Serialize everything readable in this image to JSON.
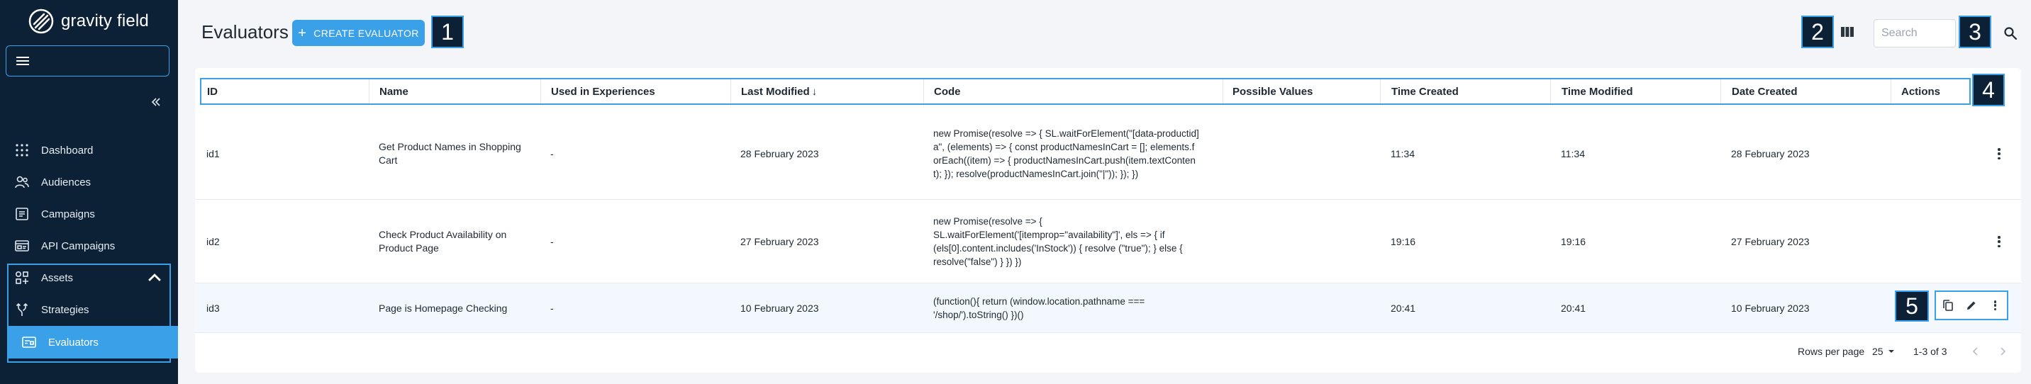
{
  "app": {
    "logo_text": "gravity field"
  },
  "sidebar": {
    "items": [
      {
        "label": "Dashboard",
        "icon": "grid-dots-icon"
      },
      {
        "label": "Audiences",
        "icon": "people-icon"
      },
      {
        "label": "Campaigns",
        "icon": "list-icon"
      },
      {
        "label": "API Campaigns",
        "icon": "api-icon"
      },
      {
        "label": "Assets",
        "icon": "shapes-icon"
      },
      {
        "label": "Strategies",
        "icon": "fork-icon"
      },
      {
        "label": "Evaluators",
        "icon": "window-icon"
      }
    ]
  },
  "header": {
    "title": "Evaluators",
    "create_label": "CREATE EVALUATOR",
    "search_placeholder": "Search"
  },
  "badges": [
    "1",
    "2",
    "3",
    "4",
    "5"
  ],
  "table": {
    "columns": [
      "ID",
      "Name",
      "Used in Experiences",
      "Last Modified",
      "Code",
      "Possible Values",
      "Time Created",
      "Time Modified",
      "Date Created",
      "Actions"
    ],
    "sort_indicator": "↓",
    "rows": [
      {
        "id": "id1",
        "name": "Get Product Names in Shopping Cart",
        "used": "-",
        "last_modified": "28 February 2023",
        "code": "new Promise(resolve => { SL.waitForElement(\"[data-productid] a\", (elements) => { const productNamesInCart = []; elements.forEach((item) => { productNamesInCart.push(item.textContent); }); resolve(productNamesInCart.join(\"|\")); }); })",
        "possible_values": "",
        "time_created": "11:34",
        "time_modified": "11:34",
        "date_created": "28 February 2023"
      },
      {
        "id": "id2",
        "name": "Check Product Availability on Product Page",
        "used": "-",
        "last_modified": "27 February 2023",
        "code": "new Promise(resolve => { SL.waitForElement('[itemprop=\"availability\"]', els => { if (els[0].content.includes('InStock')) { resolve (\"true\"); } else { resolve(\"false\") } }) })",
        "possible_values": "",
        "time_created": "19:16",
        "time_modified": "19:16",
        "date_created": "27 February 2023"
      },
      {
        "id": "id3",
        "name": "Page is Homepage Checking",
        "used": "-",
        "last_modified": "10 February 2023",
        "code": "(function(){ return (window.location.pathname === '/shop/').toString() })()",
        "possible_values": "",
        "time_created": "20:41",
        "time_modified": "20:41",
        "date_created": "10 February 2023"
      }
    ]
  },
  "footer": {
    "rows_per_page_label": "Rows per page",
    "rows_per_page_value": "25",
    "range": "1-3 of 3"
  },
  "colors": {
    "sidebar_bg": "#0d2136",
    "accent": "#3aa0e8",
    "page_bg": "#f3f5f8"
  }
}
